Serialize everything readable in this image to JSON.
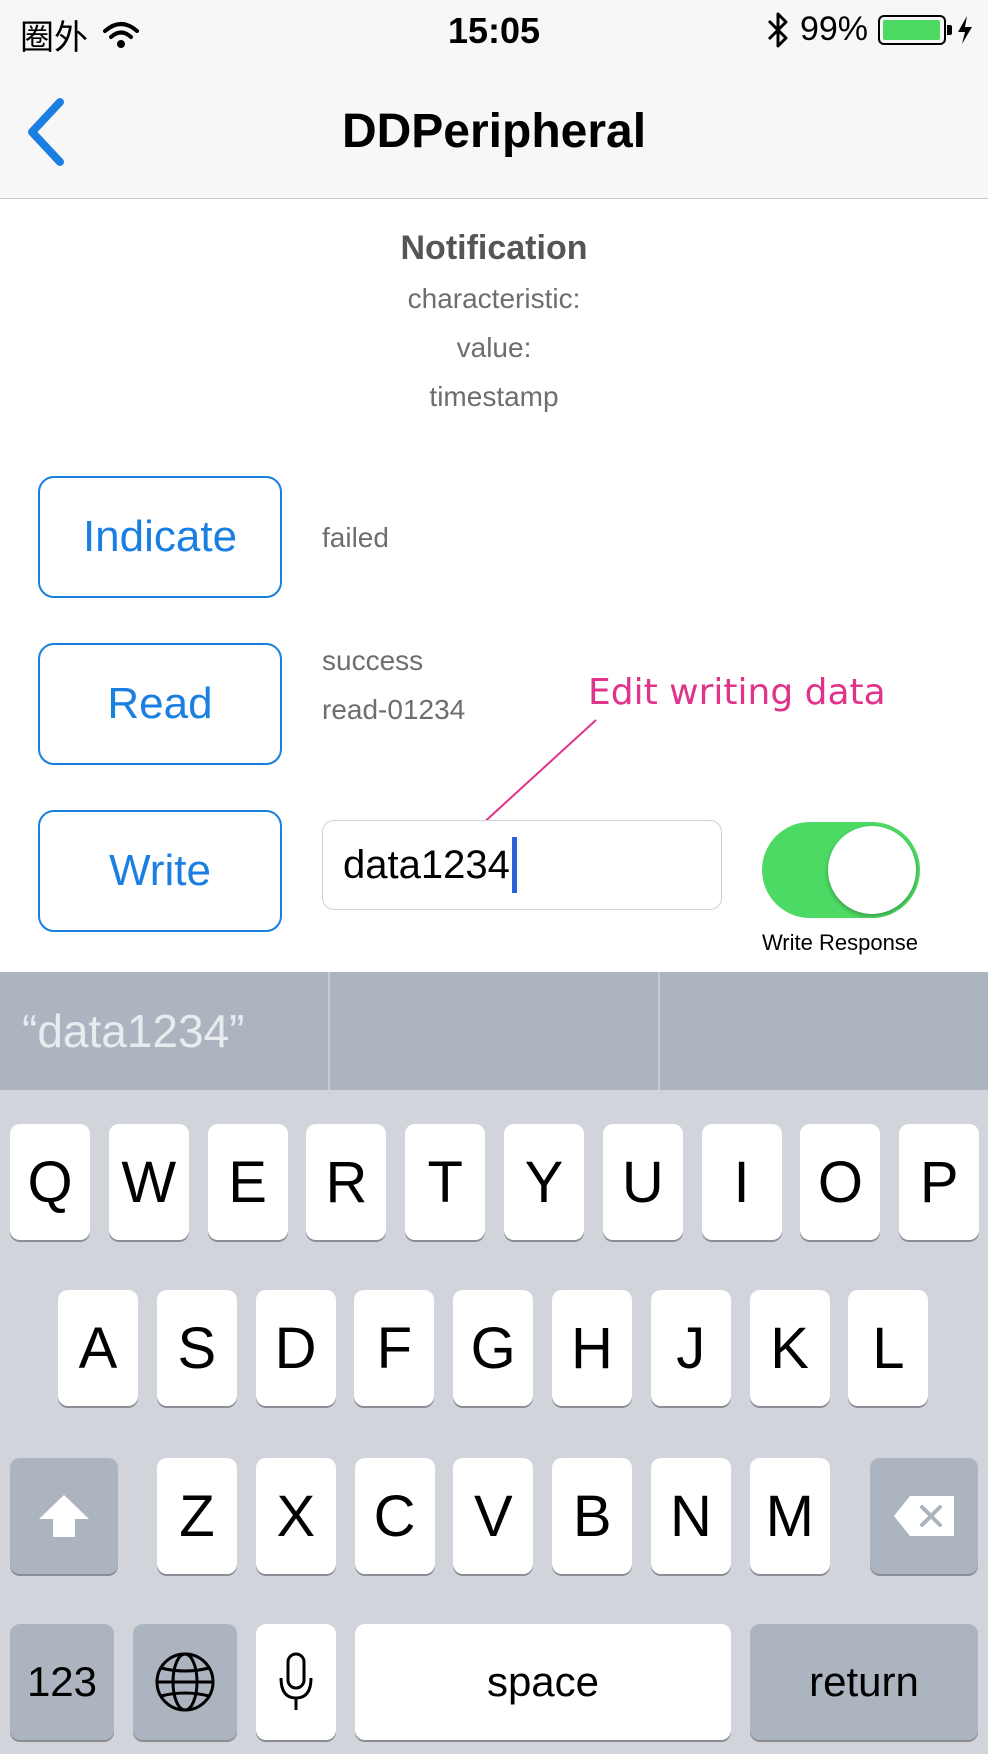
{
  "status_bar": {
    "carrier": "圈外",
    "time": "15:05",
    "battery_percent": "99%",
    "battery_level": 0.99,
    "icons": [
      "wifi-icon",
      "bluetooth-icon",
      "battery-icon",
      "charging-icon"
    ]
  },
  "nav": {
    "title": "DDPeripheral",
    "back_icon": "chevron-left-icon"
  },
  "notification": {
    "title": "Notification",
    "characteristic": "characteristic:",
    "value": "value:",
    "timestamp": "timestamp"
  },
  "actions": {
    "indicate_label": "Indicate",
    "indicate_result": "failed",
    "read_label": "Read",
    "read_result_status": "success",
    "read_result_value": "read-01234",
    "write_label": "Write",
    "write_value": "data1234"
  },
  "write_response": {
    "label": "Write Response",
    "on": true
  },
  "annotation": {
    "text": "Edit writing data"
  },
  "predictive": [
    "“data1234”",
    "",
    ""
  ],
  "keyboard": {
    "row1": [
      "Q",
      "W",
      "E",
      "R",
      "T",
      "Y",
      "U",
      "I",
      "O",
      "P"
    ],
    "row2": [
      "A",
      "S",
      "D",
      "F",
      "G",
      "H",
      "J",
      "K",
      "L"
    ],
    "row3": [
      "Z",
      "X",
      "C",
      "V",
      "B",
      "N",
      "M"
    ],
    "numbers_label": "123",
    "space_label": "space",
    "return_label": "return",
    "icons": [
      "shift-icon",
      "delete-icon",
      "globe-icon",
      "microphone-icon"
    ]
  },
  "colors": {
    "accent": "#1a7fe0",
    "toggle_on": "#4cd964",
    "annotation": "#e0338a"
  }
}
